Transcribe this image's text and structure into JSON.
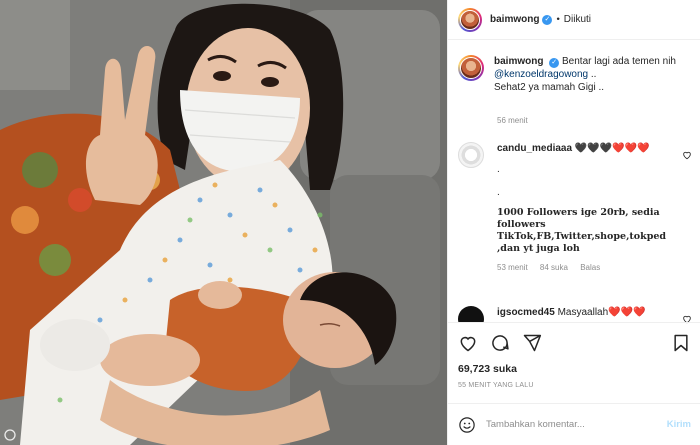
{
  "post": {
    "username": "baimwong",
    "verified_mark": "✓",
    "follow_separator": "•",
    "follow_status": "Diikuti",
    "caption_user": "baimwong",
    "caption_line1": "Bentar lagi ada temen nih",
    "caption_mention": "@kenzoeldragowong",
    "caption_mention_suffix": " ..",
    "caption_line3": "Sehat2 ya mamah Gigi ..",
    "caption_time": "56 menit",
    "likes": "69,723 suka",
    "posted_ago": "55 MENIT YANG LALU",
    "comment_placeholder": "Tambahkan komentar...",
    "post_button": "Kirim"
  },
  "comments": [
    {
      "user": "candu_mediaaa",
      "hearts": "🖤🖤🖤❤️❤️❤️",
      "dot1": ".",
      "dot2": ".",
      "promo": "1000 Followers ige 20rb, sedia followers TikTok,FB,Twitter,shope,tokped ,dan yt juga loh",
      "time": "53 menit",
      "likes": "84 suka",
      "reply": "Balas",
      "like_icon": "heart-outline-icon"
    },
    {
      "user": "igsocmed45",
      "text": "Masyaallah",
      "hearts": "❤️❤️❤️",
      "like_icon": "heart-outline-icon"
    }
  ],
  "icons": [
    "heart-outline-icon",
    "comment-icon",
    "share-icon",
    "bookmark-icon",
    "emoji-icon",
    "verified-badge-icon"
  ],
  "colors": {
    "accent": "#3897f0",
    "link": "#00376b",
    "muted": "#8e8e8e",
    "post_button_disabled": "#b2dffc",
    "divider": "#efefef"
  }
}
